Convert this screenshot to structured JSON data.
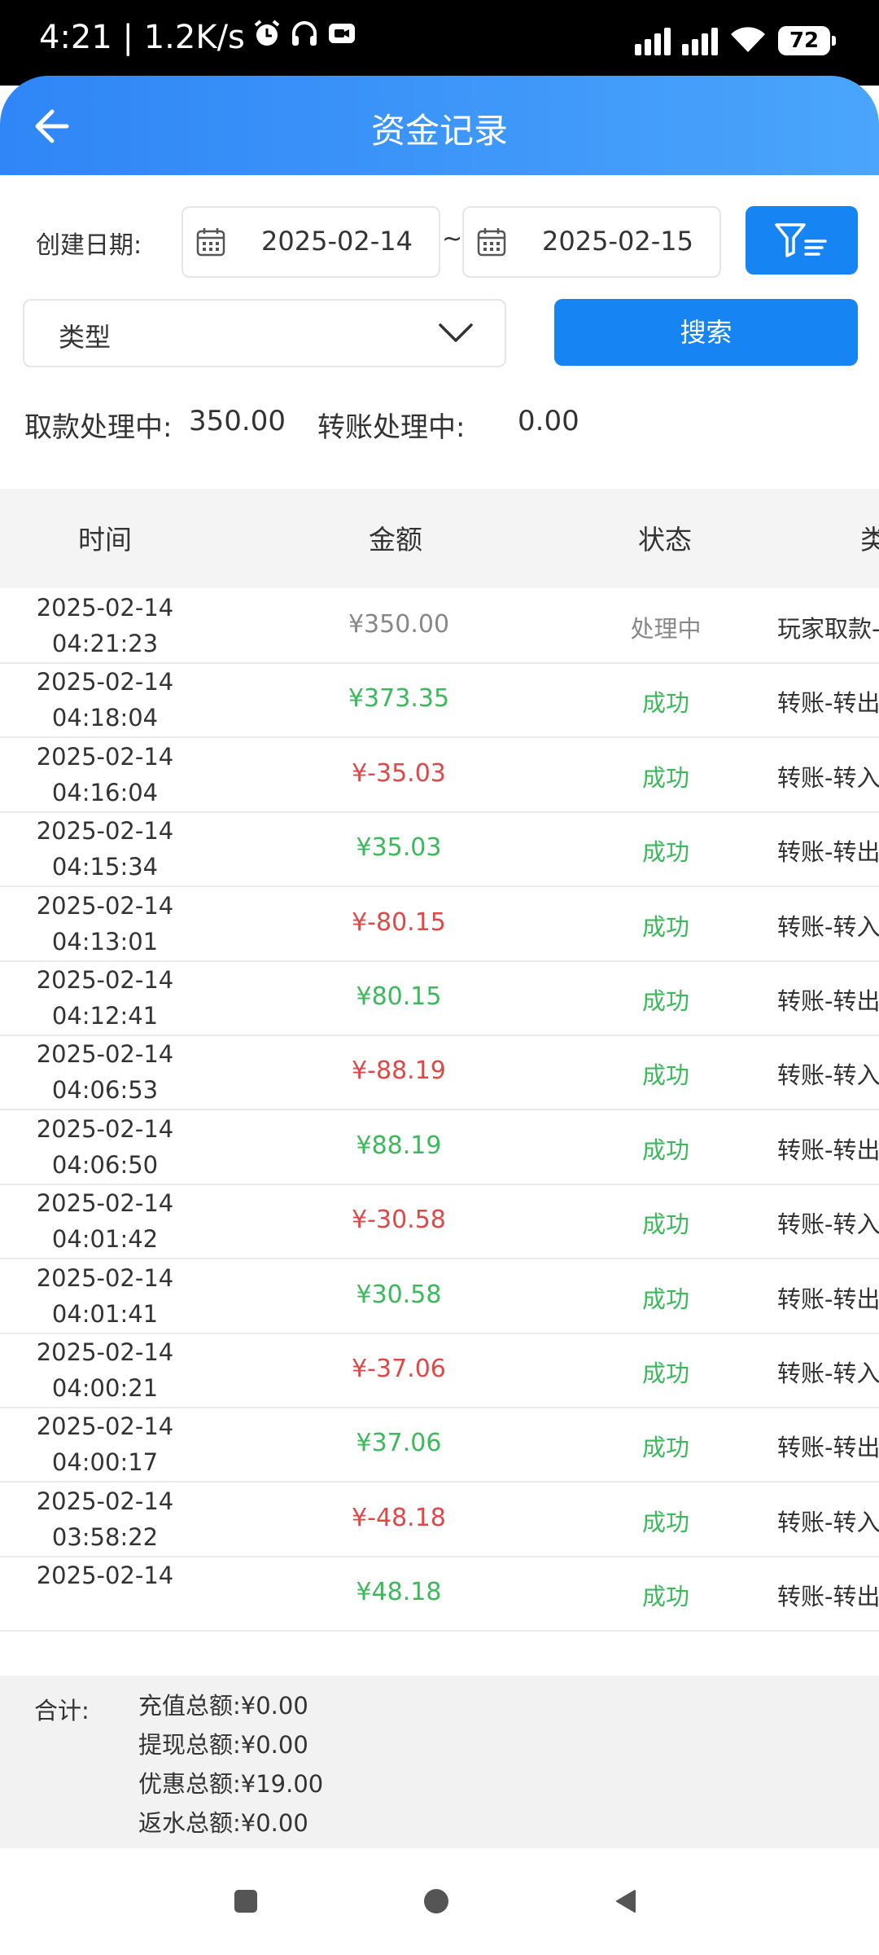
{
  "status_bar": {
    "time_speed": "4:21 | 1.2K/s",
    "battery": "72"
  },
  "header": {
    "title": "资金记录"
  },
  "filters": {
    "date_label": "创建日期:",
    "start_date": "2025-02-14",
    "separator": "~",
    "end_date": "2025-02-15",
    "type_placeholder": "类型",
    "search_label": "搜索"
  },
  "pending": {
    "withdraw_label": "取款处理中:",
    "withdraw_value": "350.00",
    "transfer_label": "转账处理中:",
    "transfer_value": "0.00"
  },
  "table": {
    "headers": [
      "时间",
      "金额",
      "状态",
      "类"
    ],
    "rows": [
      {
        "date": "2025-02-14",
        "time": "04:21:23",
        "amount": "¥350.00",
        "status": "处理中",
        "type": "玩家取款-"
      },
      {
        "date": "2025-02-14",
        "time": "04:18:04",
        "amount": "¥373.35",
        "status": "成功",
        "type": "转账-转出"
      },
      {
        "date": "2025-02-14",
        "time": "04:16:04",
        "amount": "¥-35.03",
        "status": "成功",
        "type": "转账-转入"
      },
      {
        "date": "2025-02-14",
        "time": "04:15:34",
        "amount": "¥35.03",
        "status": "成功",
        "type": "转账-转出"
      },
      {
        "date": "2025-02-14",
        "time": "04:13:01",
        "amount": "¥-80.15",
        "status": "成功",
        "type": "转账-转入"
      },
      {
        "date": "2025-02-14",
        "time": "04:12:41",
        "amount": "¥80.15",
        "status": "成功",
        "type": "转账-转出"
      },
      {
        "date": "2025-02-14",
        "time": "04:06:53",
        "amount": "¥-88.19",
        "status": "成功",
        "type": "转账-转入"
      },
      {
        "date": "2025-02-14",
        "time": "04:06:50",
        "amount": "¥88.19",
        "status": "成功",
        "type": "转账-转出"
      },
      {
        "date": "2025-02-14",
        "time": "04:01:42",
        "amount": "¥-30.58",
        "status": "成功",
        "type": "转账-转入"
      },
      {
        "date": "2025-02-14",
        "time": "04:01:41",
        "amount": "¥30.58",
        "status": "成功",
        "type": "转账-转出"
      },
      {
        "date": "2025-02-14",
        "time": "04:00:21",
        "amount": "¥-37.06",
        "status": "成功",
        "type": "转账-转入"
      },
      {
        "date": "2025-02-14",
        "time": "04:00:17",
        "amount": "¥37.06",
        "status": "成功",
        "type": "转账-转出"
      },
      {
        "date": "2025-02-14",
        "time": "03:58:22",
        "amount": "¥-48.18",
        "status": "成功",
        "type": "转账-转入"
      },
      {
        "date": "2025-02-14",
        "time": "",
        "amount": "¥48.18",
        "status": "成功",
        "type": "转账-转出"
      }
    ]
  },
  "summary": {
    "label": "合计:",
    "lines": [
      {
        "label": "充值总额:",
        "value": "¥0.00"
      },
      {
        "label": "提现总额:",
        "value": "¥0.00"
      },
      {
        "label": "优惠总额:",
        "value": "¥19.00"
      },
      {
        "label": "返水总额:",
        "value": "¥0.00"
      }
    ]
  },
  "colors": {
    "accent": "#1685f3",
    "positive": "#3cb95b",
    "negative": "#e04848",
    "pending": "#888888"
  }
}
